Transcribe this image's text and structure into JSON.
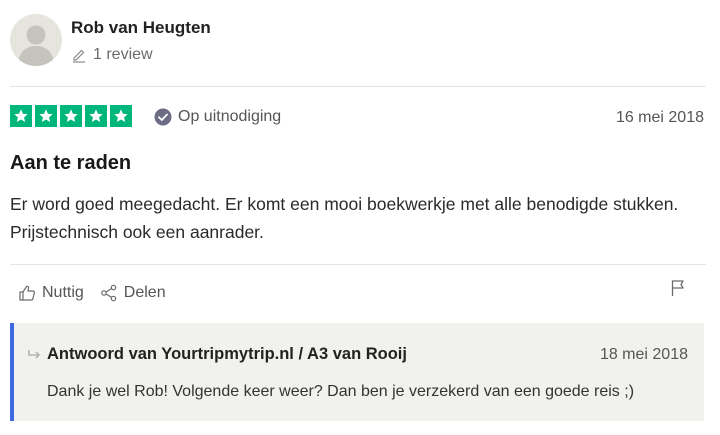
{
  "reviewer": {
    "name": "Rob van Heugten",
    "review_count": "1 review"
  },
  "review": {
    "rating": 5,
    "rating_max": 5,
    "star_color": "#00b67a",
    "verified_label": "Op uitnodiging",
    "date": "16 mei 2018",
    "title": "Aan te raden",
    "body": "Er word goed meegedacht. Er komt een mooi boekwerkje met alle benodigde stukken. Prijstechnisch ook een aanrader."
  },
  "actions": {
    "useful_label": "Nuttig",
    "share_label": "Delen"
  },
  "reply": {
    "title": "Antwoord van Yourtripmytrip.nl / A3 van Rooij",
    "date": "18 mei 2018",
    "body": "Dank je wel Rob! Volgende keer weer? Dan ben je verzekerd van een goede reis ;)",
    "accent_color": "#3d6ae0"
  }
}
